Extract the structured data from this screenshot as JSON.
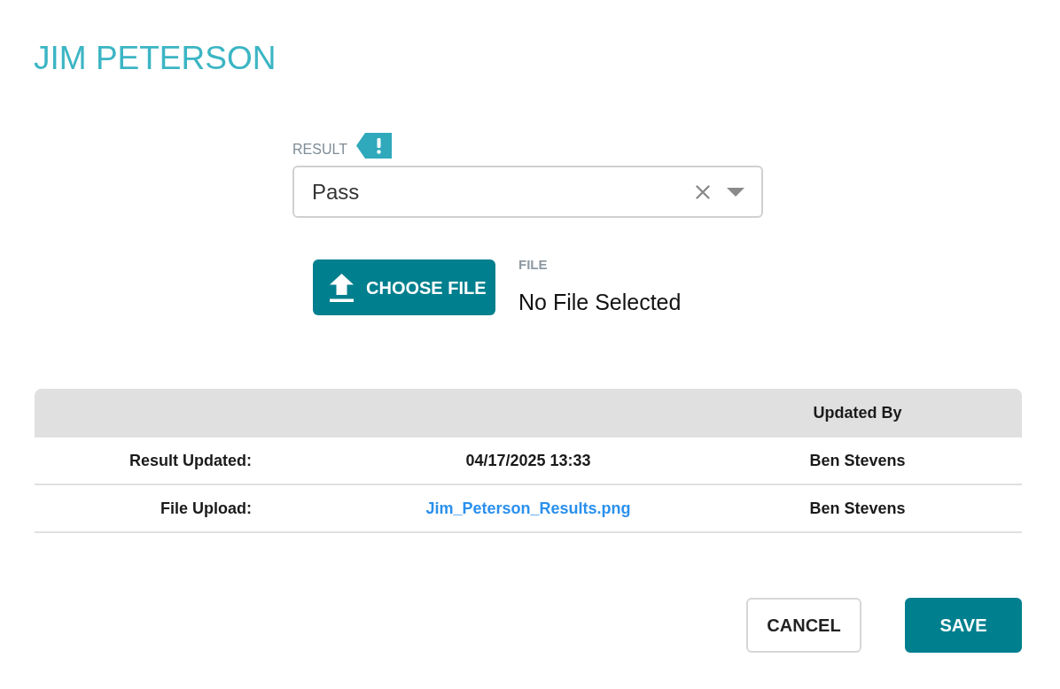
{
  "title": "JIM PETERSON",
  "result_field": {
    "label": "RESULT",
    "required": true,
    "value": "Pass"
  },
  "file_field": {
    "button": "CHOOSE FILE",
    "label": "FILE",
    "value": "No File Selected"
  },
  "table": {
    "header": {
      "column_3": "Updated By"
    },
    "rows": [
      {
        "label": "Result Updated:",
        "kind": "text",
        "value": "04/17/2025 13:33",
        "updated_by": "Ben Stevens"
      },
      {
        "label": "File Upload:",
        "kind": "link",
        "value": "Jim_Peterson_Results.png",
        "updated_by": "Ben Stevens"
      }
    ]
  },
  "buttons": [
    {
      "label": "CANCEL",
      "kind": "secondary"
    },
    {
      "label": "SAVE",
      "kind": "primary"
    }
  ]
}
